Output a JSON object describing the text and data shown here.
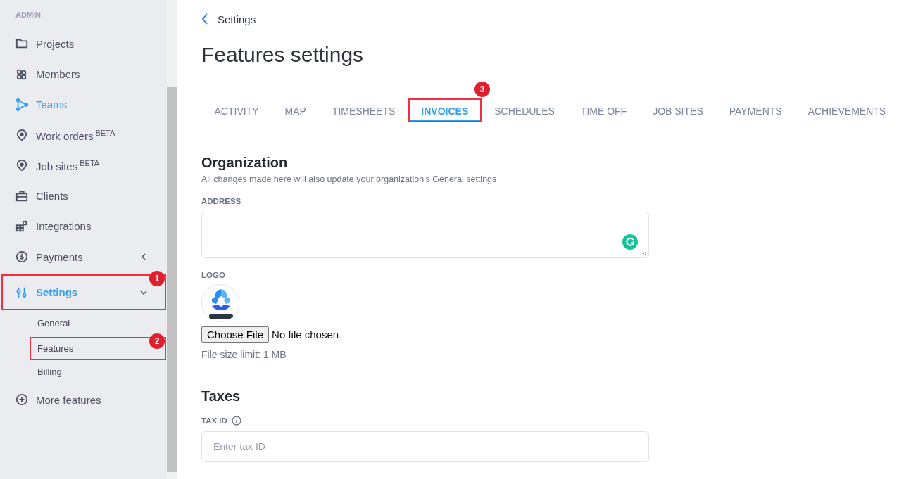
{
  "sidebar": {
    "heading": "ADMIN",
    "items": [
      {
        "label": "Projects",
        "highlighted": false
      },
      {
        "label": "Members",
        "highlighted": false
      },
      {
        "label": "Teams",
        "highlighted": true
      },
      {
        "label": "Work orders",
        "badge": "BETA",
        "highlighted": false
      },
      {
        "label": "Job sites",
        "badge": "BETA",
        "highlighted": false
      },
      {
        "label": "Clients",
        "highlighted": false
      },
      {
        "label": "Integrations",
        "highlighted": false
      },
      {
        "label": "Payments",
        "highlighted": false,
        "expanded": false
      },
      {
        "label": "Settings",
        "highlighted": true,
        "expanded": true,
        "callout": "1",
        "children": [
          {
            "label": "General"
          },
          {
            "label": "Features",
            "callout": "2"
          },
          {
            "label": "Billing"
          }
        ]
      },
      {
        "label": "More features",
        "highlighted": false
      }
    ]
  },
  "back_link": "Settings",
  "title": "Features settings",
  "tabs": [
    {
      "label": "ACTIVITY",
      "selected": false
    },
    {
      "label": "MAP",
      "selected": false
    },
    {
      "label": "TIMESHEETS",
      "selected": false
    },
    {
      "label": "INVOICES",
      "selected": true,
      "callout": "3"
    },
    {
      "label": "SCHEDULES",
      "selected": false
    },
    {
      "label": "TIME OFF",
      "selected": false
    },
    {
      "label": "JOB SITES",
      "selected": false
    },
    {
      "label": "PAYMENTS",
      "selected": false
    },
    {
      "label": "ACHIEVEMENTS",
      "selected": false
    }
  ],
  "sections": [
    {
      "title": "Organization",
      "subtitle": "All changes made here will also update your organization's General settings",
      "fields": [
        {
          "kind": "textarea",
          "label": "ADDRESS"
        },
        {
          "kind": "file",
          "label": "LOGO",
          "button": "Choose File",
          "status": "No file chosen",
          "hint": "File size limit: 1 MB"
        }
      ]
    },
    {
      "title": "Taxes",
      "fields": [
        {
          "kind": "text",
          "label": "TAX ID",
          "info": true,
          "placeholder": "Enter tax ID"
        }
      ]
    }
  ]
}
